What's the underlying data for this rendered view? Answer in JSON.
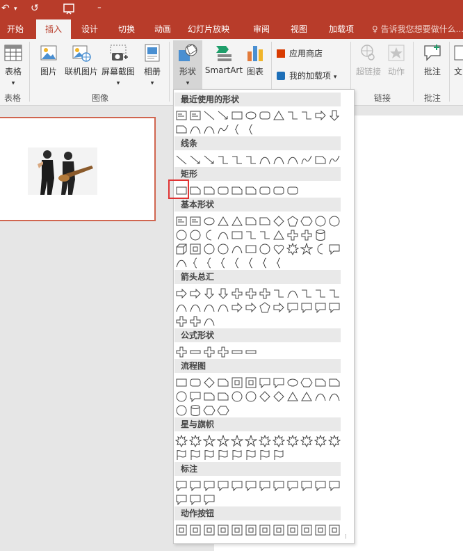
{
  "titlebar": {
    "undo": "↶",
    "redo": "↺",
    "more": "⁼"
  },
  "tabs": [
    {
      "label": "开始",
      "active": false
    },
    {
      "label": "插入",
      "active": true
    },
    {
      "label": "设计",
      "active": false
    },
    {
      "label": "切换",
      "active": false
    },
    {
      "label": "动画",
      "active": false
    },
    {
      "label": "幻灯片放映",
      "active": false
    },
    {
      "label": "审阅",
      "active": false
    },
    {
      "label": "视图",
      "active": false
    },
    {
      "label": "加载项",
      "active": false
    }
  ],
  "tell_me": "告诉我您想要做什么...",
  "ribbon": {
    "table": "表格",
    "table_group": "表格",
    "picture": "图片",
    "online_picture": "联机图片",
    "screenshot": "屏幕截图",
    "album": "相册",
    "image_group": "图像",
    "shapes": "形状",
    "smartart": "SmartArt",
    "chart": "图表",
    "store": "应用商店",
    "my_addins": "我的加载项",
    "hyperlink": "超链接",
    "action": "动作",
    "link_group": "链接",
    "comment": "批注",
    "comment_group": "批注",
    "text_partial": "文"
  },
  "gallery": {
    "sections": [
      "最近使用的形状",
      "线条",
      "矩形",
      "基本形状",
      "箭头总汇",
      "公式形状",
      "流程图",
      "星与旗帜",
      "标注",
      "动作按钮"
    ],
    "selected": "矩形"
  },
  "colors": {
    "accent": "#b83c2a",
    "highlight": "#e03333",
    "thumb_border": "#d0654f"
  }
}
